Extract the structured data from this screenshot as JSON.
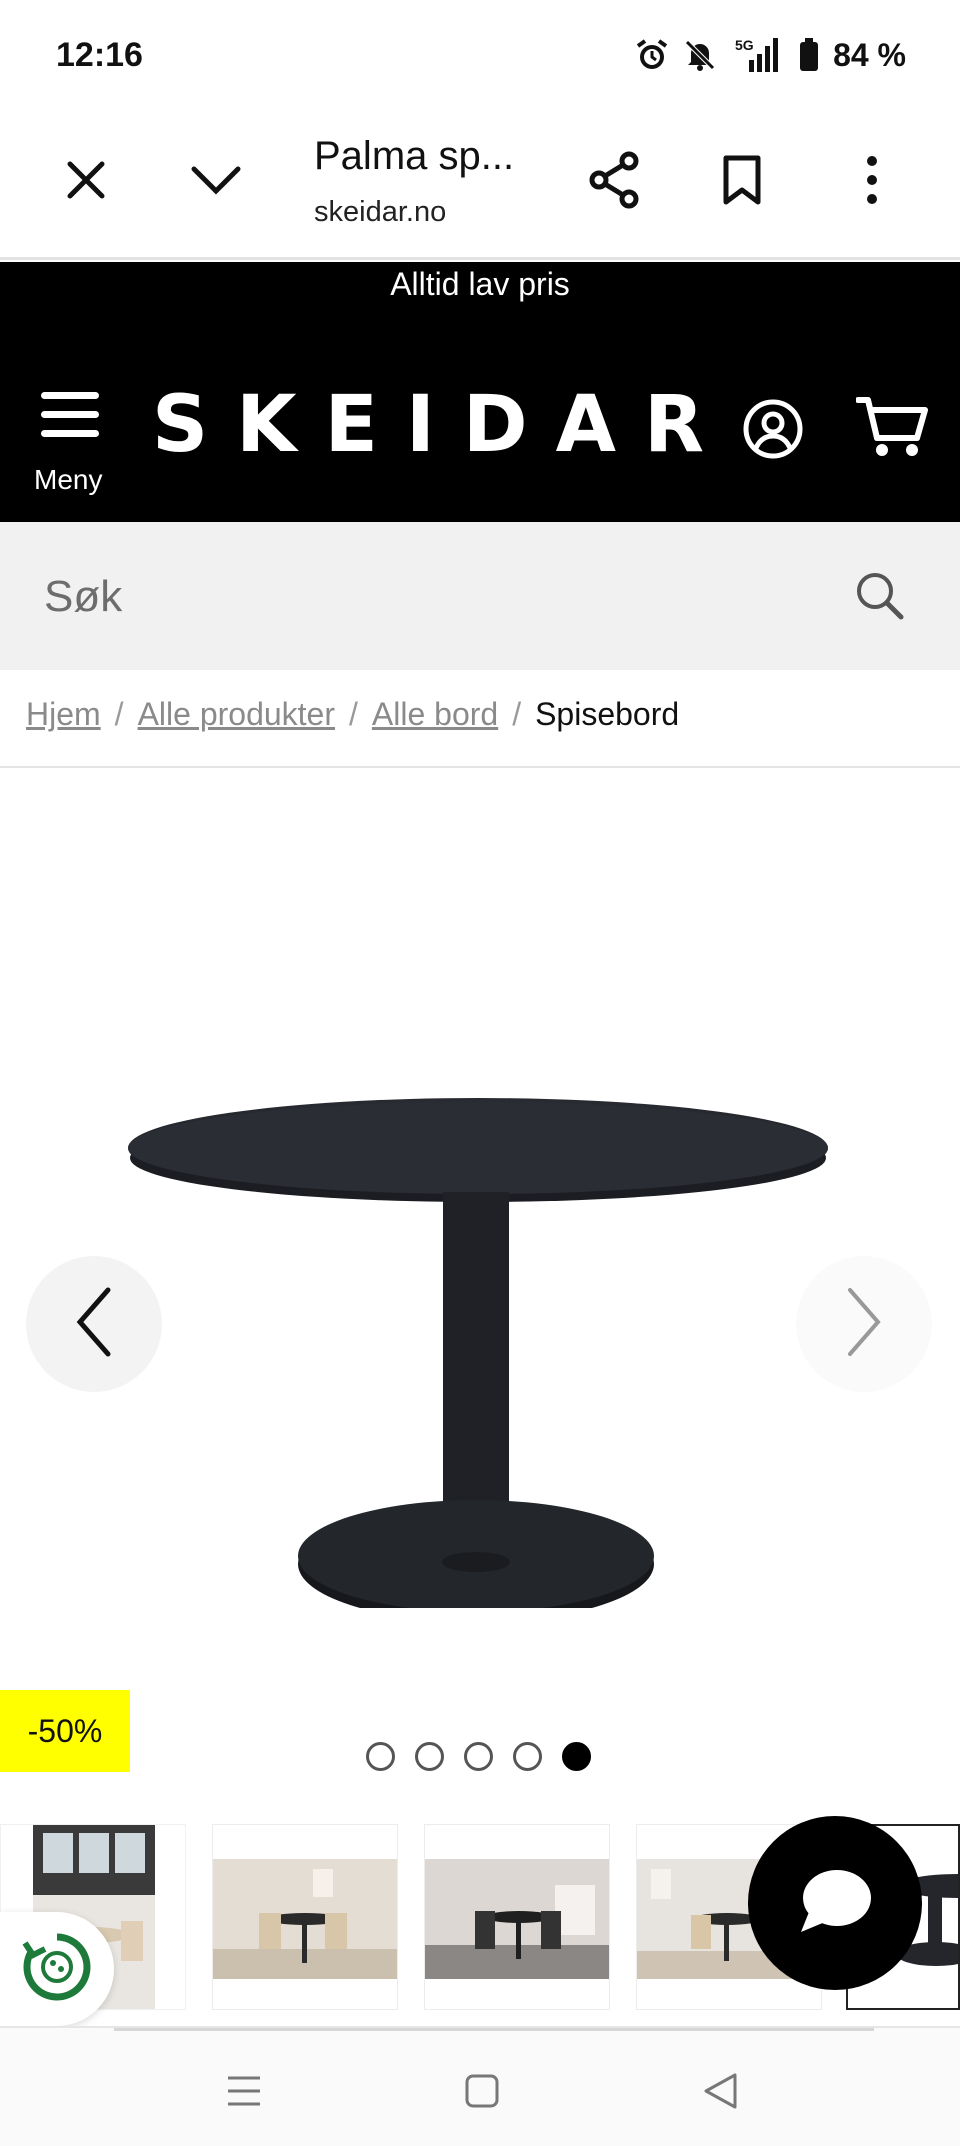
{
  "status_bar": {
    "time": "12:16",
    "network": "5G",
    "battery": "84 %",
    "icons": [
      "alarm-icon",
      "bell-off-icon",
      "signal-5g-icon",
      "battery-icon"
    ]
  },
  "browser": {
    "tab_title": "Palma sp...",
    "domain": "skeidar.no",
    "icons": [
      "close-icon",
      "chevron-down-icon",
      "share-icon",
      "bookmark-icon",
      "more-vert-icon"
    ]
  },
  "header": {
    "promo": "Alltid lav pris",
    "menu_label": "Meny",
    "logo": "SKEIDAR",
    "icons": [
      "menu-icon",
      "account-icon",
      "cart-icon"
    ]
  },
  "search": {
    "placeholder": "Søk",
    "value": ""
  },
  "breadcrumb": {
    "items": [
      "Hjem",
      "Alle produkter",
      "Alle bord"
    ],
    "current": "Spisebord",
    "separator": "/"
  },
  "gallery": {
    "discount": "-50%",
    "dot_count": 5,
    "active_dot": 5,
    "accent_badge": "#ffff00"
  },
  "colors": {
    "header_bg": "#000000",
    "search_bg": "#f1f1f1",
    "link_gray": "#8a8a8a"
  }
}
